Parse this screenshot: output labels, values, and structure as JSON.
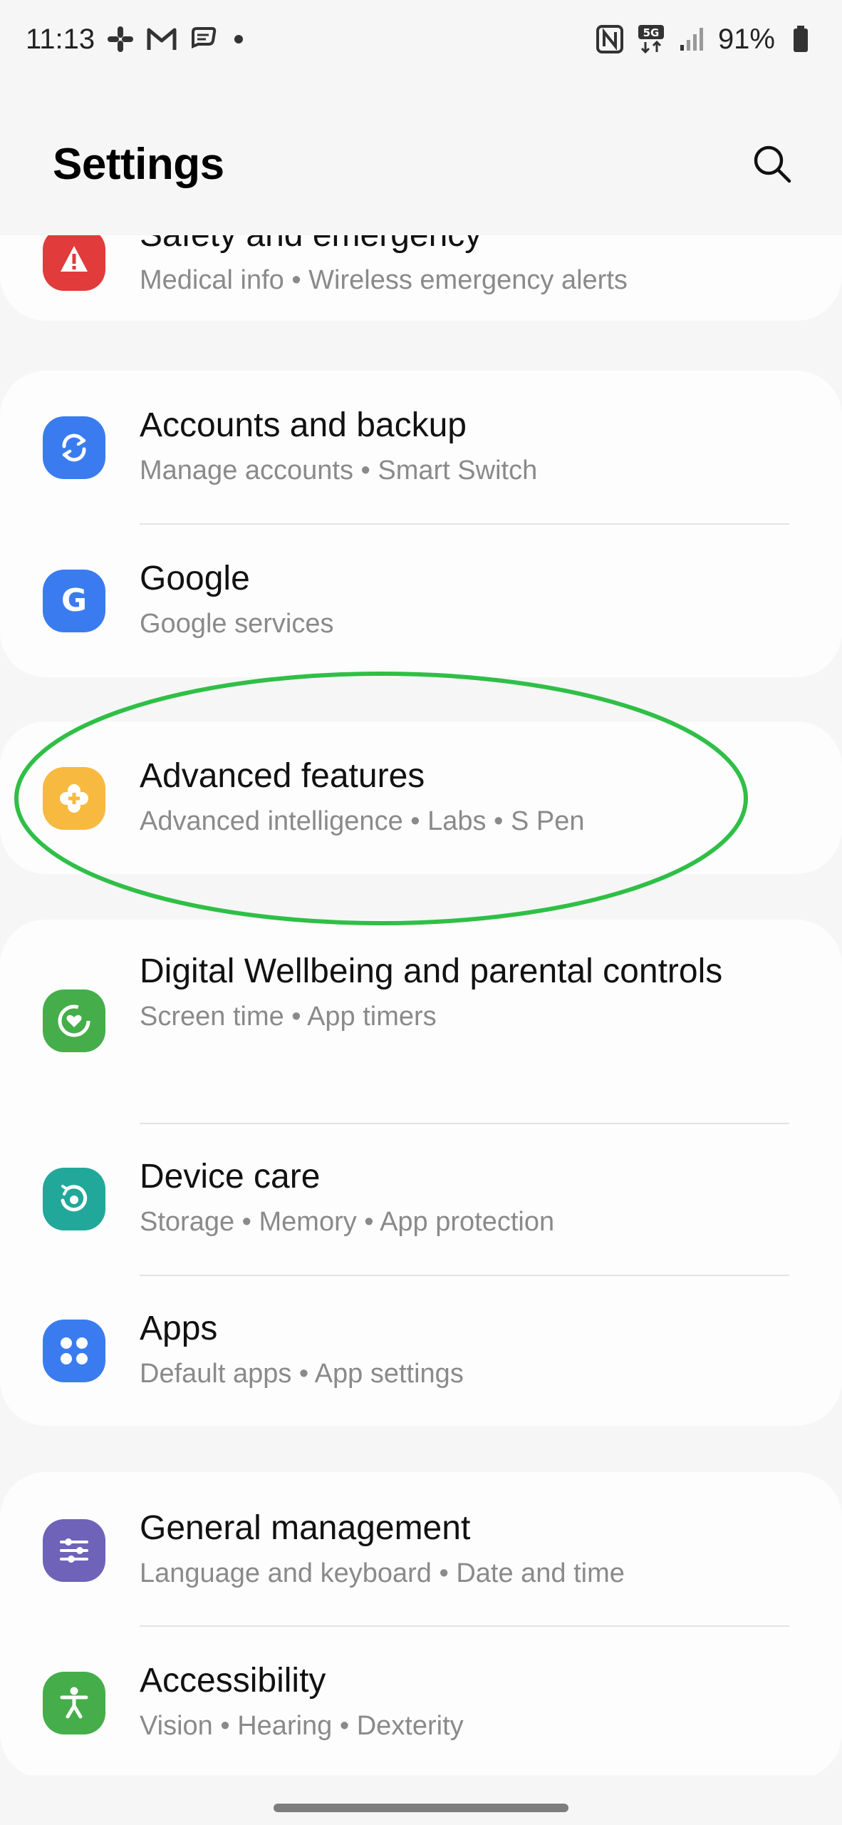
{
  "status_bar": {
    "time": "11:13",
    "battery": "91%",
    "network": "5G"
  },
  "header": {
    "title": "Settings"
  },
  "items": [
    {
      "title": "Safety and emergency",
      "subtitle": "Medical info  •  Wireless emergency alerts",
      "icon": "safety-alert-icon",
      "color": "#e23b3b"
    },
    {
      "title": "Accounts and backup",
      "subtitle": "Manage accounts  •  Smart Switch",
      "icon": "sync-icon",
      "color": "#3a7cf0"
    },
    {
      "title": "Google",
      "subtitle": "Google services",
      "icon": "google-icon",
      "color": "#3a7cf0"
    },
    {
      "title": "Advanced features",
      "subtitle": "Advanced intelligence  •  Labs  •  S Pen",
      "icon": "advanced-features-icon",
      "color": "#f8b940"
    },
    {
      "title": "Digital Wellbeing and parental controls",
      "subtitle": "Screen time  •  App timers",
      "icon": "digital-wellbeing-icon",
      "color": "#45ae4a"
    },
    {
      "title": "Device care",
      "subtitle": "Storage  •  Memory  •  App protection",
      "icon": "device-care-icon",
      "color": "#21a89a"
    },
    {
      "title": "Apps",
      "subtitle": "Default apps  •  App settings",
      "icon": "apps-grid-icon",
      "color": "#3a7cf0"
    },
    {
      "title": "General management",
      "subtitle": "Language and keyboard  •  Date and time",
      "icon": "sliders-icon",
      "color": "#6e63b8"
    },
    {
      "title": "Accessibility",
      "subtitle": "Vision  •  Hearing  •  Dexterity",
      "icon": "accessibility-icon",
      "color": "#45ae4a"
    }
  ],
  "annotation": {
    "color": "#2fbf46"
  }
}
